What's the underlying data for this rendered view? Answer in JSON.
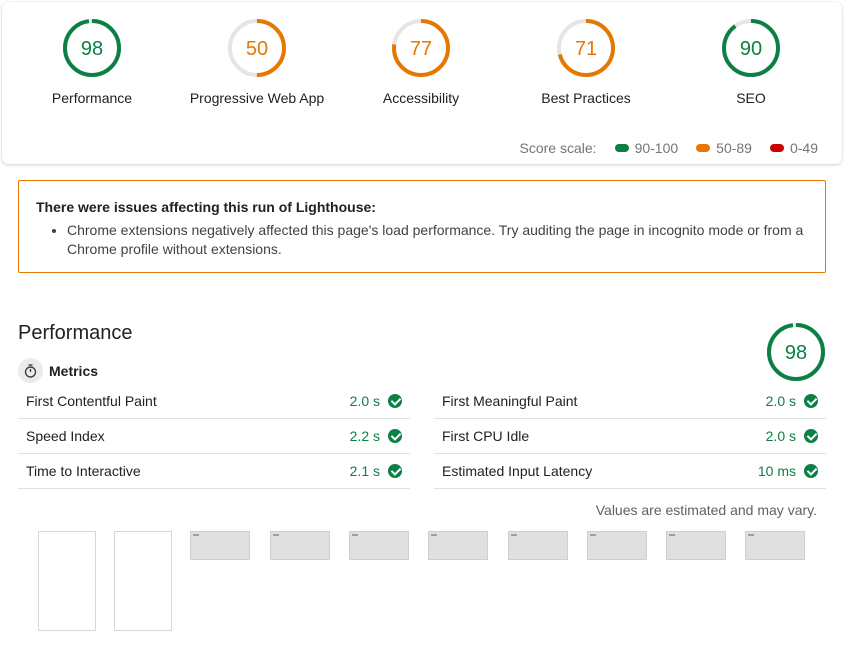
{
  "summary": {
    "gauges": [
      {
        "score": "98",
        "label": "Performance",
        "color": "#0b8043",
        "fraction": 0.98
      },
      {
        "score": "50",
        "label": "Progressive Web App",
        "color": "#e67700",
        "fraction": 0.5
      },
      {
        "score": "77",
        "label": "Accessibility",
        "color": "#e67700",
        "fraction": 0.77
      },
      {
        "score": "71",
        "label": "Best Practices",
        "color": "#e67700",
        "fraction": 0.71
      },
      {
        "score": "90",
        "label": "SEO",
        "color": "#0b8043",
        "fraction": 0.9
      }
    ],
    "scale_label": "Score scale:",
    "scale": [
      {
        "range": "90-100",
        "color": "#0b8043"
      },
      {
        "range": "50-89",
        "color": "#e67700"
      },
      {
        "range": "0-49",
        "color": "#cc0000"
      }
    ]
  },
  "warning": {
    "title": "There were issues affecting this run of Lighthouse:",
    "items": [
      "Chrome extensions negatively affected this page's load performance. Try auditing the page in incognito mode or from a Chrome profile without extensions."
    ]
  },
  "performance": {
    "title": "Performance",
    "score": "98",
    "score_fraction": 0.98,
    "metrics_label": "Metrics",
    "metrics_left": [
      {
        "name": "First Contentful Paint",
        "value": "2.0 s"
      },
      {
        "name": "Speed Index",
        "value": "2.2 s"
      },
      {
        "name": "Time to Interactive",
        "value": "2.1 s"
      }
    ],
    "metrics_right": [
      {
        "name": "First Meaningful Paint",
        "value": "2.0 s"
      },
      {
        "name": "First CPU Idle",
        "value": "2.0 s"
      },
      {
        "name": "Estimated Input Latency",
        "value": "10 ms"
      }
    ],
    "note": "Values are estimated and may vary."
  },
  "icons": {
    "metrics": "stopwatch-icon",
    "pass": "check-circle-icon"
  }
}
